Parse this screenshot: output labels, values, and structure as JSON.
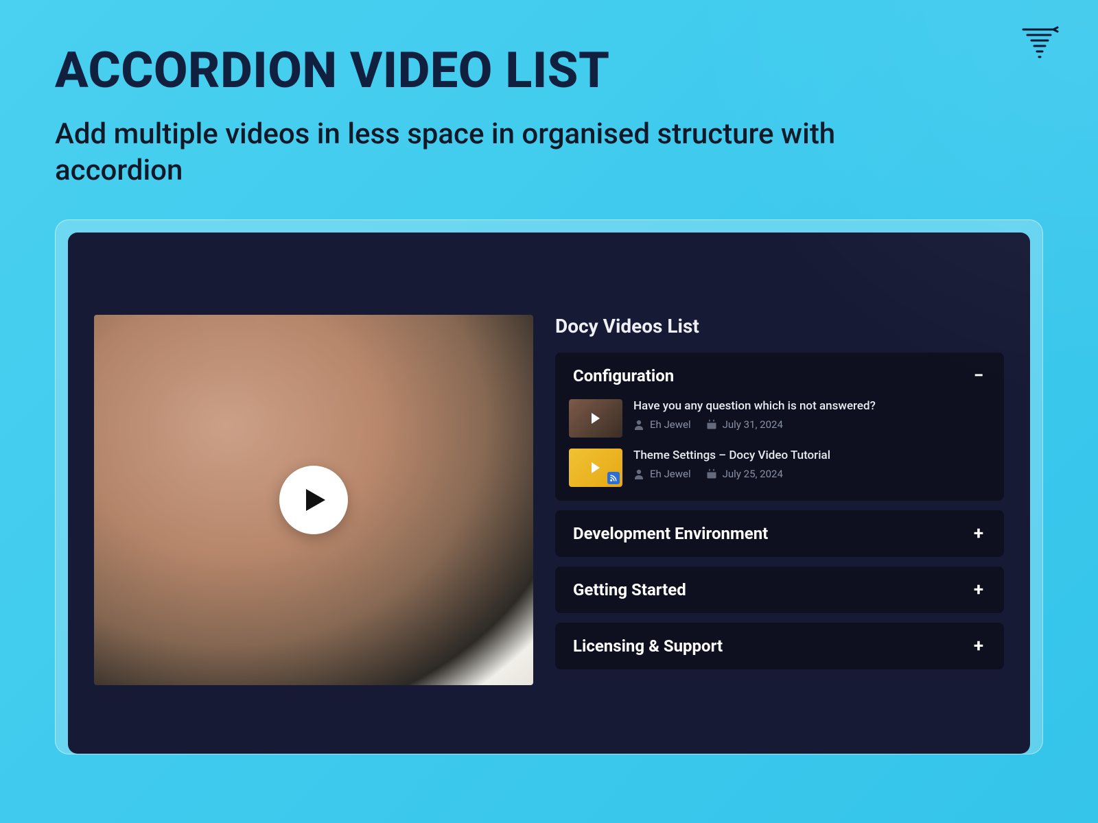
{
  "hero": {
    "title": "ACCORDION VIDEO LIST",
    "subtitle": "Add multiple videos in less space in organised structure with accordion"
  },
  "list_title": "Docy Videos List",
  "accordion": [
    {
      "title": "Configuration",
      "expanded": true,
      "videos": [
        {
          "title": "Have you any question which is not answered?",
          "author": "Eh Jewel",
          "date": "July 31, 2024"
        },
        {
          "title": "Theme Settings – Docy Video Tutorial",
          "author": "Eh Jewel",
          "date": "July 25, 2024"
        }
      ]
    },
    {
      "title": "Development Environment",
      "expanded": false
    },
    {
      "title": "Getting Started",
      "expanded": false
    },
    {
      "title": "Licensing & Support",
      "expanded": false
    }
  ]
}
